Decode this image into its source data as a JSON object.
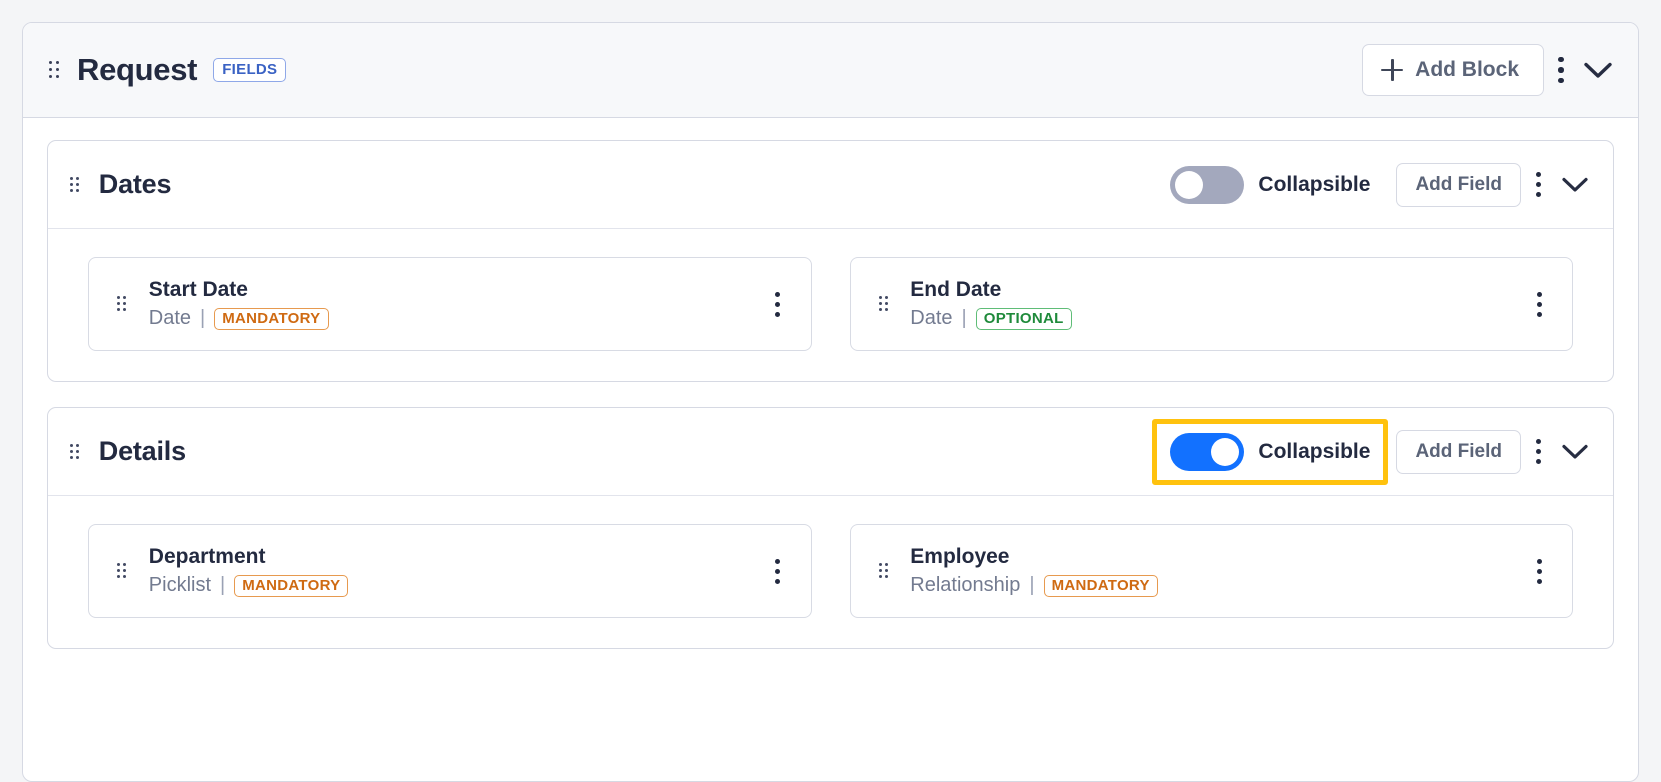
{
  "block": {
    "title": "Request",
    "badge": "FIELDS",
    "drag_handle": "drag-handle",
    "add_block_label": "Add Block",
    "plus_icon": "plus-icon",
    "more_icon": "kebab-menu-icon",
    "collapse_icon": "chevron-down-icon"
  },
  "colors": {
    "toggle_on": "#1271ff",
    "toggle_off": "#a3a8bd",
    "highlight": "#ffc20e",
    "mandatory": "#cf6a12",
    "optional": "#1f8a3b",
    "badge_blue": "#3a62c4"
  },
  "common": {
    "collapsible_label": "Collapsible",
    "add_field_label": "Add Field"
  },
  "sections": [
    {
      "title": "Dates",
      "collapsible_on": false,
      "highlighted": false,
      "fields": [
        {
          "name": "Start Date",
          "type": "Date",
          "separator": "|",
          "requirement": "MANDATORY",
          "requirement_kind": "mandatory"
        },
        {
          "name": "End Date",
          "type": "Date",
          "separator": "|",
          "requirement": "OPTIONAL",
          "requirement_kind": "optional"
        }
      ]
    },
    {
      "title": "Details",
      "collapsible_on": true,
      "highlighted": true,
      "fields": [
        {
          "name": "Department",
          "type": "Picklist",
          "separator": "|",
          "requirement": "MANDATORY",
          "requirement_kind": "mandatory"
        },
        {
          "name": "Employee",
          "type": "Relationship",
          "separator": "|",
          "requirement": "MANDATORY",
          "requirement_kind": "mandatory"
        }
      ]
    }
  ]
}
